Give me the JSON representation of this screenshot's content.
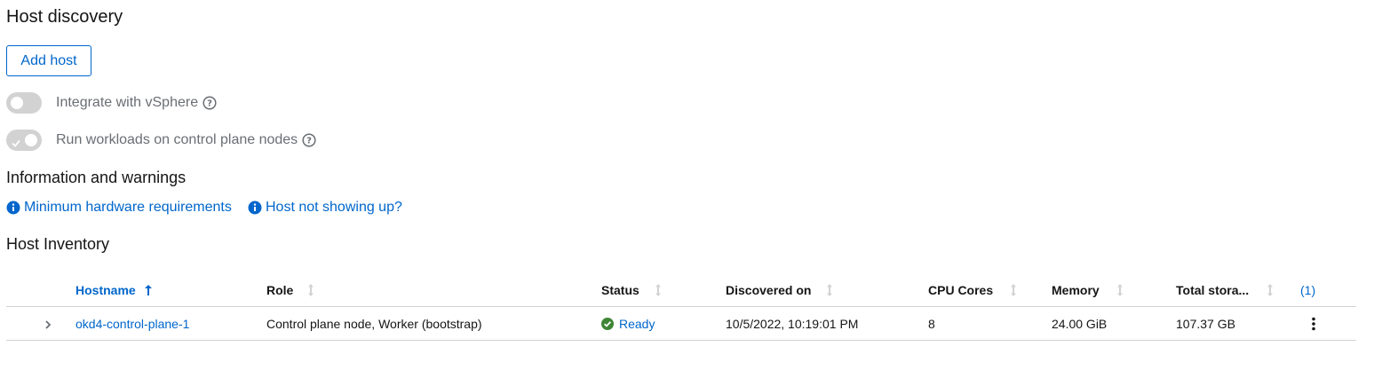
{
  "page": {
    "title": "Host discovery",
    "add_host_label": "Add host"
  },
  "toggles": [
    {
      "label": "Integrate with vSphere",
      "state": "off"
    },
    {
      "label": "Run workloads on control plane nodes",
      "state": "on"
    }
  ],
  "info_section": {
    "title": "Information and warnings",
    "links": [
      "Minimum hardware requirements",
      "Host not showing up?"
    ]
  },
  "inventory": {
    "title": "Host Inventory",
    "columns": [
      "Hostname",
      "Role",
      "Status",
      "Discovered on",
      "CPU Cores",
      "Memory",
      "Total stora..."
    ],
    "column_count_label": "(1)",
    "rows": [
      {
        "hostname": "okd4-control-plane-1",
        "role": "Control plane node, Worker (bootstrap)",
        "status": "Ready",
        "discovered_on": "10/5/2022, 10:19:01 PM",
        "cpu_cores": "8",
        "memory": "24.00 GiB",
        "total_storage": "107.37 GB"
      }
    ]
  },
  "colors": {
    "link": "#0066cc",
    "success": "#3e8635",
    "toggle_disabled": "#d2d2d2",
    "muted_text": "#6a6e73"
  },
  "icons": {
    "help": "question-circle-icon",
    "info": "info-circle-icon",
    "sort_asc": "sort-asc-icon",
    "sort": "sort-icon",
    "expand": "chevron-right-icon",
    "status": "check-circle-icon",
    "kebab": "kebab-icon"
  }
}
